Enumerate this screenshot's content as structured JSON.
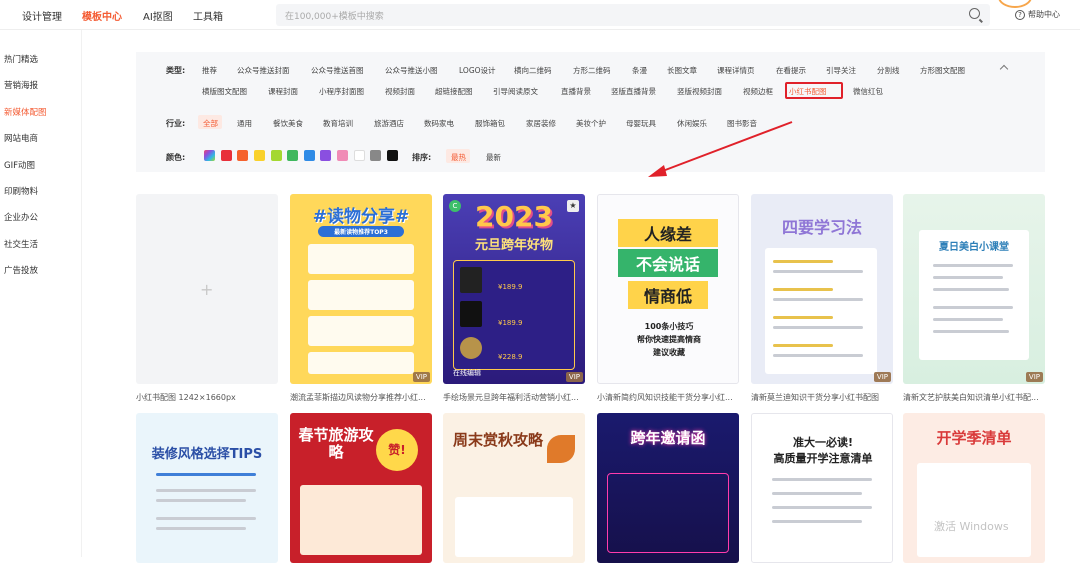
{
  "topnav": {
    "items": [
      "设计管理",
      "模板中心",
      "AI抠图",
      "工具箱"
    ],
    "active": "模板中心"
  },
  "search": {
    "placeholder": "在100,000+模板中搜索"
  },
  "help": {
    "label": "帮助中心"
  },
  "sidebar": {
    "items": [
      "热门精选",
      "营销海报",
      "新媒体配图",
      "网站电商",
      "GIF动图",
      "印刷物料",
      "企业办公",
      "社交生活",
      "广告投放"
    ],
    "active": "新媒体配图"
  },
  "filters": {
    "type_label": "类型:",
    "types_row1": [
      "推荐",
      "公众号推送封面",
      "公众号推送首图",
      "公众号推送小图",
      "LOGO设计",
      "横向二维码",
      "方形二维码",
      "条漫",
      "长图文章",
      "课程详情页",
      "在看提示",
      "引导关注",
      "分割线",
      "方形图文配图"
    ],
    "types_row2": [
      "横版图文配图",
      "课程封面",
      "小程序封面图",
      "视频封面",
      "超链接配图",
      "引导阅读原文",
      "直播背景",
      "竖版直播背景",
      "竖版视频封面",
      "视频边框",
      "小红书配图",
      "微信红包"
    ],
    "type_active": "小红书配图",
    "industry_label": "行业:",
    "industries": [
      "全部",
      "通用",
      "餐饮美食",
      "教育培训",
      "旅游酒店",
      "数码家电",
      "服饰箱包",
      "家居装修",
      "美妆个护",
      "母婴玩具",
      "休闲娱乐",
      "图书影音"
    ],
    "industry_active": "全部",
    "color_label": "颜色:",
    "colors": [
      "#e8303a",
      "#f5622d",
      "#f9d12b",
      "#a4d831",
      "#3fb85e",
      "#2f8be6",
      "#8a4fe0",
      "#f08bb6",
      "#ffffff",
      "#888888",
      "#111111"
    ],
    "sort_label": "排序:",
    "sorts": [
      "最热",
      "最新"
    ],
    "sort_active": "最热"
  },
  "grid": {
    "placeholder_caption": "小红书配图 1242×1660px",
    "badges": {
      "vip": "VIP",
      "online_edit": "在线编辑"
    },
    "row1": [
      {
        "caption": "潮流孟菲斯描边风读物分享推荐小红...",
        "title": "#读物分享#",
        "subtitle": "最新读物推荐TOP3"
      },
      {
        "caption": "手绘场景元旦跨年福利活动营销小红...",
        "title": "2023",
        "subtitle": "元旦跨年好物",
        "prices": [
          "¥189.9",
          "¥189.9",
          "¥228.9"
        ]
      },
      {
        "caption": "小清新简约风知识技能干货分享小红...",
        "lines": [
          "人缘差",
          "不会说话",
          "情商低"
        ],
        "footer": [
          "100条小技巧",
          "帮你快速提高情商",
          "建议收藏"
        ]
      },
      {
        "caption": "清新莫兰迪知识干货分享小红书配图",
        "title": "四要学习法"
      },
      {
        "caption": "清新文艺护肤美白知识清单小红书配...",
        "title": "夏日美白小课堂"
      }
    ],
    "row2": [
      {
        "title": "装修风格选择TIPS"
      },
      {
        "title": "春节旅游攻略",
        "badge": "赞!"
      },
      {
        "title": "周末赏秋攻略"
      },
      {
        "title": "跨年邀请函"
      },
      {
        "title": "准大一必读!",
        "subtitle": "高质量开学注意清单"
      },
      {
        "title": "开学季清单"
      }
    ]
  },
  "watermark": "激活 Windows"
}
